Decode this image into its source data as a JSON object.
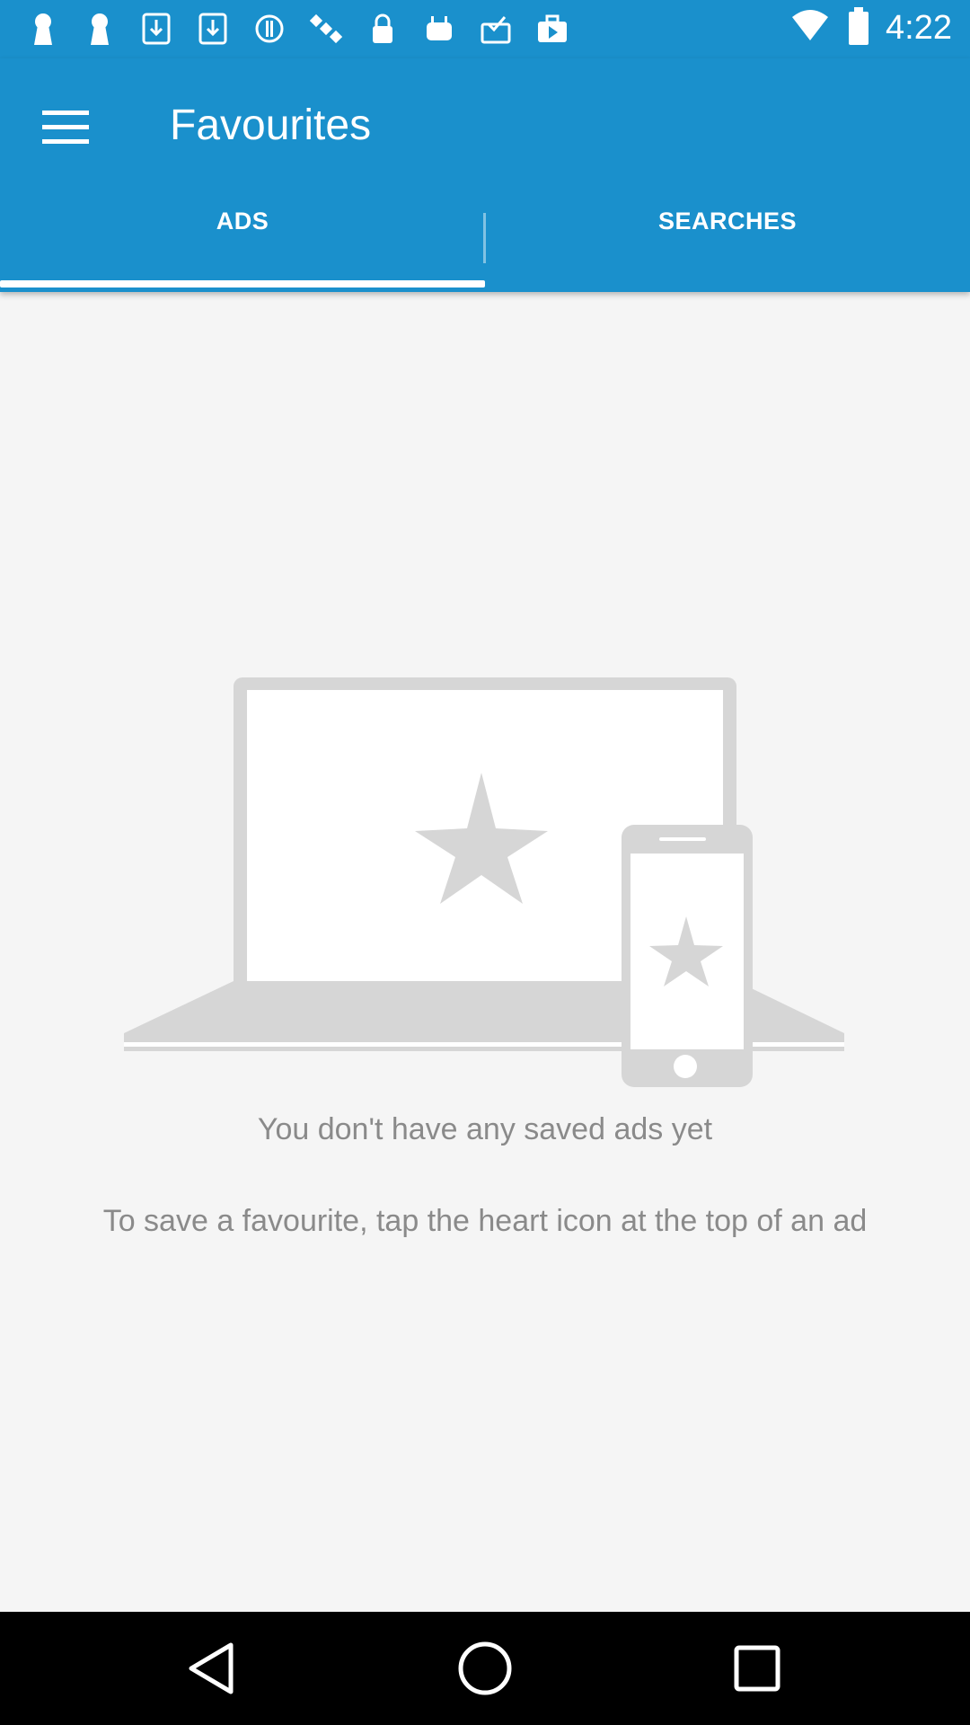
{
  "status_bar": {
    "time": "4:22",
    "icons": [
      "keyhole-icon",
      "keyhole-icon",
      "download-icon",
      "download-icon",
      "circle-info-icon",
      "satellite-icon",
      "lock-icon",
      "android-icon",
      "check-mail-icon",
      "briefcase-icon"
    ],
    "right_icons": [
      "wifi-icon",
      "battery-icon"
    ]
  },
  "app_bar": {
    "title": "Favourites",
    "menu_icon": "hamburger-menu-icon"
  },
  "tabs": [
    {
      "label": "ADS",
      "selected": true
    },
    {
      "label": "SEARCHES",
      "selected": false
    }
  ],
  "empty_state": {
    "title": "You don't have any saved ads yet",
    "hint": "To save a favourite, tap the heart icon at the top of an ad",
    "illustration": "laptop-phone-star-illustration"
  },
  "nav_bar": {
    "buttons": [
      "back-icon",
      "home-icon",
      "recents-icon"
    ]
  },
  "colors": {
    "primary": "#1a90cc",
    "background": "#f5f5f5",
    "text_muted": "#8a8a8a",
    "illustration_gray": "#d6d6d6"
  }
}
